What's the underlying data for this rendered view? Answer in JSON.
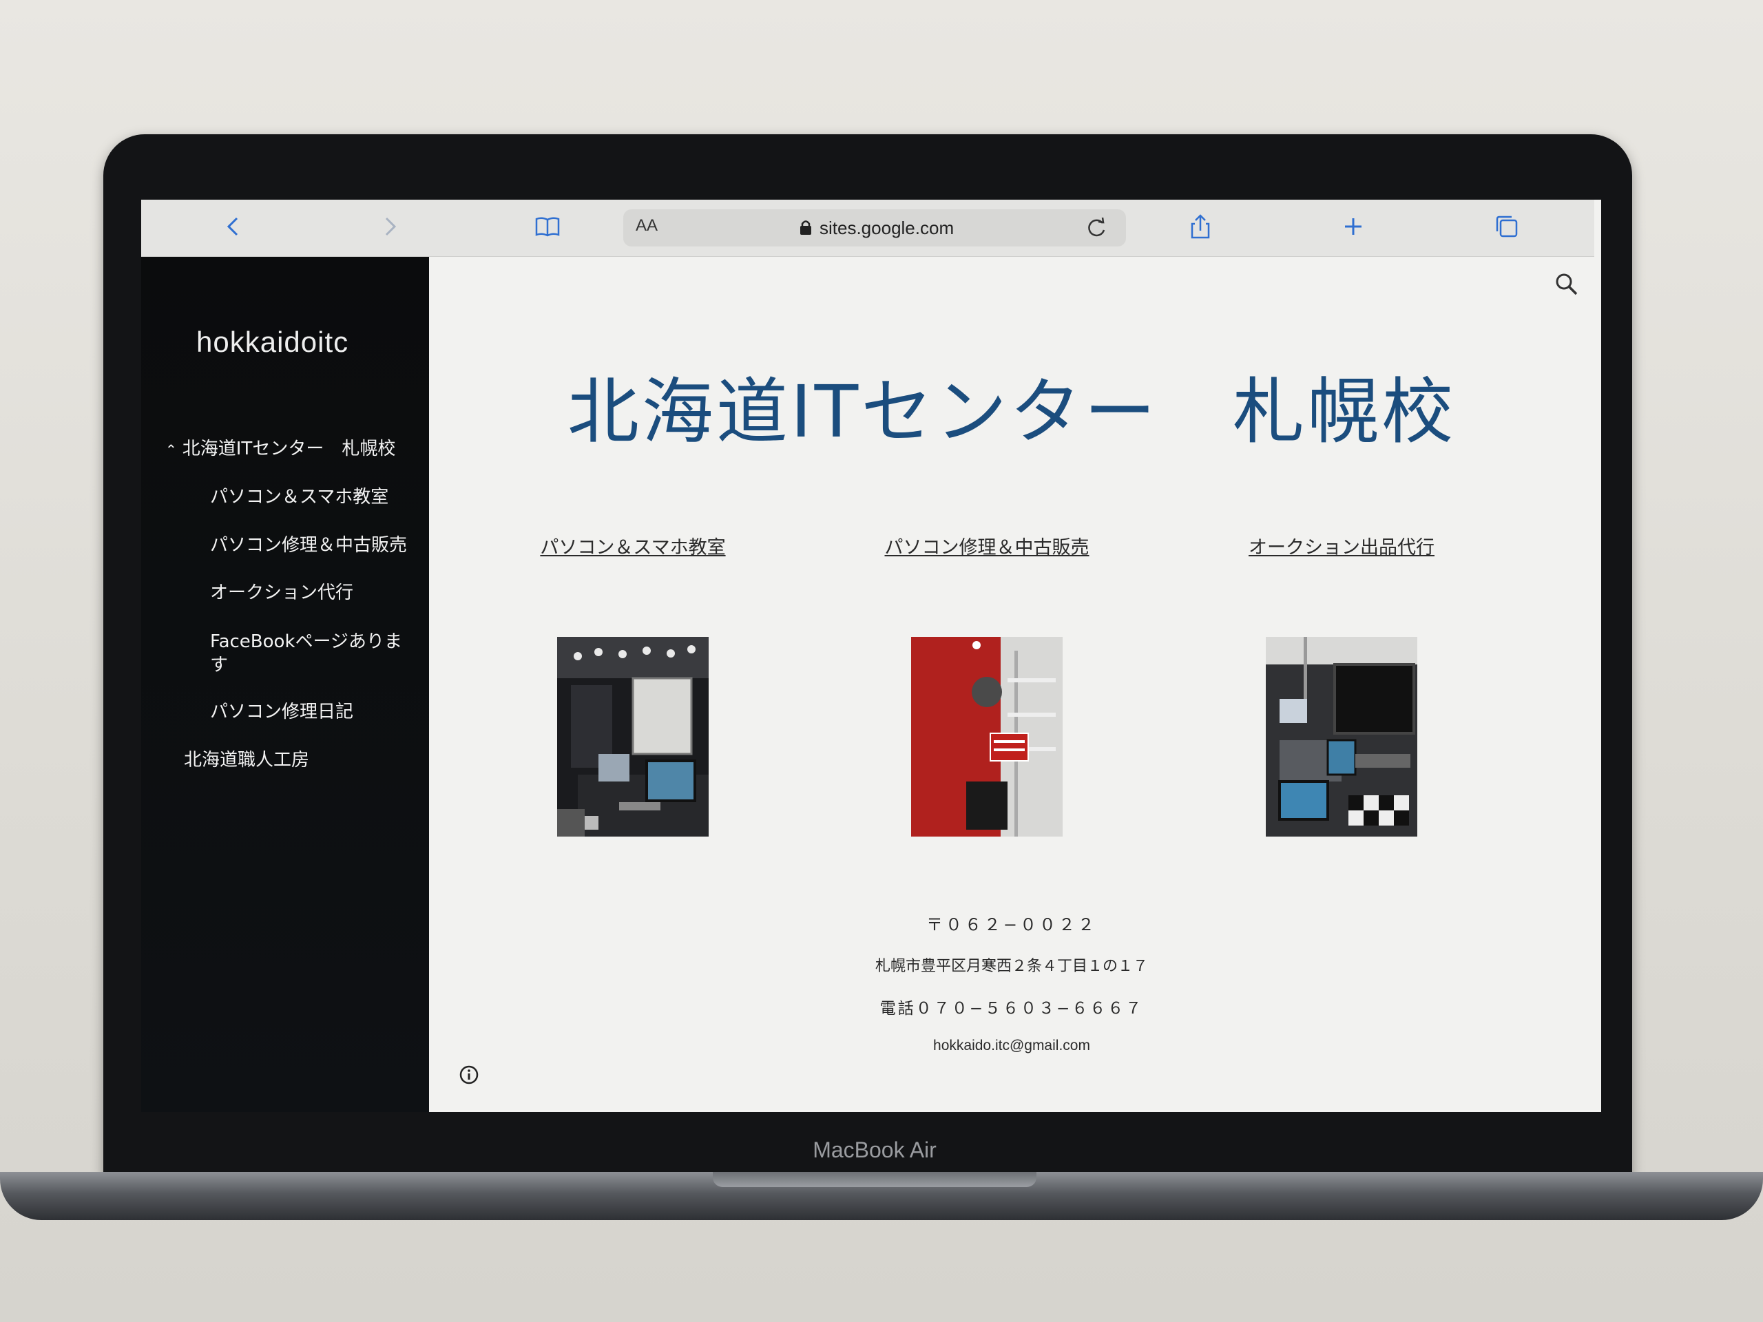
{
  "browser": {
    "reader_label": "AA",
    "url": "sites.google.com",
    "icons": [
      "back-icon",
      "forward-icon",
      "bookmarks-icon",
      "lock-icon",
      "reload-icon",
      "share-icon",
      "new-tab-icon",
      "tabs-icon"
    ]
  },
  "sidebar": {
    "site_name": "hokkaidoitc",
    "items": [
      {
        "label": "北海道ITセンター　札幌校",
        "expanded": true
      },
      {
        "label": "パソコン＆スマホ教室"
      },
      {
        "label": "パソコン修理＆中古販売"
      },
      {
        "label": "オークション代行"
      },
      {
        "label": "FaceBookページありま",
        "label2": "す"
      },
      {
        "label": "パソコン修理日記"
      },
      {
        "label": "北海道職人工房"
      }
    ]
  },
  "main": {
    "title": "北海道ITセンター　札幌校",
    "columns": [
      {
        "link": "パソコン＆スマホ教室",
        "image": "classroom-photo"
      },
      {
        "link": "パソコン修理＆中古販売",
        "image": "shop-entrance-photo"
      },
      {
        "link": "オークション出品代行",
        "image": "repair-desk-photo"
      }
    ],
    "postal": "〒０６２−００２２",
    "address": "札幌市豊平区月寒西２条４丁目１の１７",
    "phone": "電話０７０−５６０３−６６６７",
    "email": "hokkaido.itc@gmail.com"
  },
  "device": {
    "model": "MacBook Air"
  },
  "colors": {
    "title": "#1b4d7e",
    "sidebar_bg": "#0c0d0f",
    "page_bg": "#f2f2f0"
  }
}
